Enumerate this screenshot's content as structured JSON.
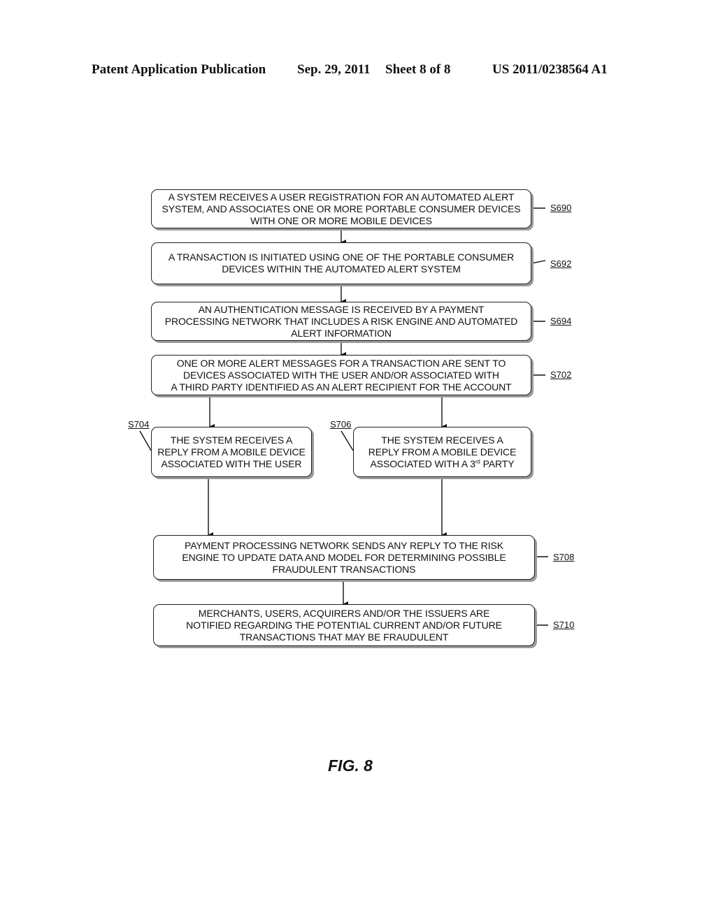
{
  "header": {
    "publication_type": "Patent Application Publication",
    "date": "Sep. 29, 2011",
    "sheet": "Sheet 8 of 8",
    "patent_number": "US 2011/0238564 A1"
  },
  "flowchart": {
    "steps": [
      {
        "id": "S690",
        "lines": [
          "A SYSTEM RECEIVES A USER REGISTRATION FOR AN AUTOMATED ALERT",
          "SYSTEM, AND ASSOCIATES ONE OR MORE PORTABLE CONSUMER DEVICES",
          "WITH ONE OR MORE MOBILE DEVICES"
        ]
      },
      {
        "id": "S692",
        "lines": [
          "A TRANSACTION IS INITIATED USING ONE OF THE PORTABLE CONSUMER",
          "DEVICES WITHIN THE AUTOMATED ALERT SYSTEM"
        ]
      },
      {
        "id": "S694",
        "lines": [
          "AN AUTHENTICATION MESSAGE IS RECEIVED BY A PAYMENT",
          "PROCESSING NETWORK THAT INCLUDES A RISK ENGINE AND AUTOMATED",
          "ALERT INFORMATION"
        ]
      },
      {
        "id": "S702",
        "lines": [
          "ONE OR MORE ALERT MESSAGES FOR A TRANSACTION ARE SENT TO",
          "DEVICES ASSOCIATED WITH THE USER AND/OR ASSOCIATED WITH",
          "A THIRD PARTY IDENTIFIED AS AN ALERT RECIPIENT FOR THE ACCOUNT"
        ]
      },
      {
        "id": "S704",
        "lines": [
          "THE SYSTEM RECEIVES A",
          "REPLY FROM A MOBILE DEVICE",
          "ASSOCIATED WITH THE USER"
        ]
      },
      {
        "id": "S706",
        "lines": [
          "THE SYSTEM RECEIVES A",
          "REPLY FROM A MOBILE DEVICE",
          "ASSOCIATED WITH A 3",
          "rd",
          " PARTY"
        ]
      },
      {
        "id": "S708",
        "lines": [
          "PAYMENT PROCESSING NETWORK SENDS ANY REPLY TO THE RISK",
          "ENGINE TO UPDATE DATA AND MODEL FOR DETERMINING POSSIBLE",
          "FRAUDULENT TRANSACTIONS"
        ]
      },
      {
        "id": "S710",
        "lines": [
          "MERCHANTS, USERS, ACQUIRERS AND/OR THE ISSUERS ARE",
          "NOTIFIED REGARDING THE POTENTIAL CURRENT AND/OR FUTURE",
          "TRANSACTIONS THAT MAY BE FRAUDULENT"
        ]
      }
    ],
    "edges": [
      [
        "S690",
        "S692"
      ],
      [
        "S692",
        "S694"
      ],
      [
        "S694",
        "S702"
      ],
      [
        "S702",
        "S704"
      ],
      [
        "S702",
        "S706"
      ],
      [
        "S704",
        "S708"
      ],
      [
        "S706",
        "S708"
      ],
      [
        "S708",
        "S710"
      ]
    ]
  },
  "figure_label": "FIG. 8"
}
